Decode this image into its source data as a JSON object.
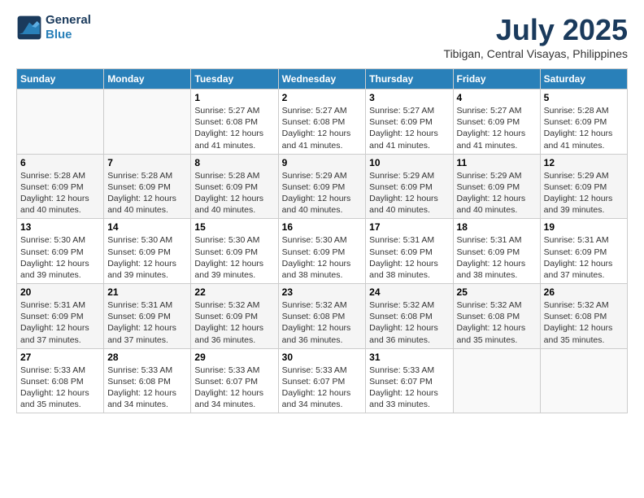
{
  "header": {
    "logo_line1": "General",
    "logo_line2": "Blue",
    "month": "July 2025",
    "location": "Tibigan, Central Visayas, Philippines"
  },
  "days_of_week": [
    "Sunday",
    "Monday",
    "Tuesday",
    "Wednesday",
    "Thursday",
    "Friday",
    "Saturday"
  ],
  "weeks": [
    [
      {
        "day": "",
        "info": ""
      },
      {
        "day": "",
        "info": ""
      },
      {
        "day": "1",
        "info": "Sunrise: 5:27 AM\nSunset: 6:08 PM\nDaylight: 12 hours and 41 minutes."
      },
      {
        "day": "2",
        "info": "Sunrise: 5:27 AM\nSunset: 6:08 PM\nDaylight: 12 hours and 41 minutes."
      },
      {
        "day": "3",
        "info": "Sunrise: 5:27 AM\nSunset: 6:09 PM\nDaylight: 12 hours and 41 minutes."
      },
      {
        "day": "4",
        "info": "Sunrise: 5:27 AM\nSunset: 6:09 PM\nDaylight: 12 hours and 41 minutes."
      },
      {
        "day": "5",
        "info": "Sunrise: 5:28 AM\nSunset: 6:09 PM\nDaylight: 12 hours and 41 minutes."
      }
    ],
    [
      {
        "day": "6",
        "info": "Sunrise: 5:28 AM\nSunset: 6:09 PM\nDaylight: 12 hours and 40 minutes."
      },
      {
        "day": "7",
        "info": "Sunrise: 5:28 AM\nSunset: 6:09 PM\nDaylight: 12 hours and 40 minutes."
      },
      {
        "day": "8",
        "info": "Sunrise: 5:28 AM\nSunset: 6:09 PM\nDaylight: 12 hours and 40 minutes."
      },
      {
        "day": "9",
        "info": "Sunrise: 5:29 AM\nSunset: 6:09 PM\nDaylight: 12 hours and 40 minutes."
      },
      {
        "day": "10",
        "info": "Sunrise: 5:29 AM\nSunset: 6:09 PM\nDaylight: 12 hours and 40 minutes."
      },
      {
        "day": "11",
        "info": "Sunrise: 5:29 AM\nSunset: 6:09 PM\nDaylight: 12 hours and 40 minutes."
      },
      {
        "day": "12",
        "info": "Sunrise: 5:29 AM\nSunset: 6:09 PM\nDaylight: 12 hours and 39 minutes."
      }
    ],
    [
      {
        "day": "13",
        "info": "Sunrise: 5:30 AM\nSunset: 6:09 PM\nDaylight: 12 hours and 39 minutes."
      },
      {
        "day": "14",
        "info": "Sunrise: 5:30 AM\nSunset: 6:09 PM\nDaylight: 12 hours and 39 minutes."
      },
      {
        "day": "15",
        "info": "Sunrise: 5:30 AM\nSunset: 6:09 PM\nDaylight: 12 hours and 39 minutes."
      },
      {
        "day": "16",
        "info": "Sunrise: 5:30 AM\nSunset: 6:09 PM\nDaylight: 12 hours and 38 minutes."
      },
      {
        "day": "17",
        "info": "Sunrise: 5:31 AM\nSunset: 6:09 PM\nDaylight: 12 hours and 38 minutes."
      },
      {
        "day": "18",
        "info": "Sunrise: 5:31 AM\nSunset: 6:09 PM\nDaylight: 12 hours and 38 minutes."
      },
      {
        "day": "19",
        "info": "Sunrise: 5:31 AM\nSunset: 6:09 PM\nDaylight: 12 hours and 37 minutes."
      }
    ],
    [
      {
        "day": "20",
        "info": "Sunrise: 5:31 AM\nSunset: 6:09 PM\nDaylight: 12 hours and 37 minutes."
      },
      {
        "day": "21",
        "info": "Sunrise: 5:31 AM\nSunset: 6:09 PM\nDaylight: 12 hours and 37 minutes."
      },
      {
        "day": "22",
        "info": "Sunrise: 5:32 AM\nSunset: 6:09 PM\nDaylight: 12 hours and 36 minutes."
      },
      {
        "day": "23",
        "info": "Sunrise: 5:32 AM\nSunset: 6:08 PM\nDaylight: 12 hours and 36 minutes."
      },
      {
        "day": "24",
        "info": "Sunrise: 5:32 AM\nSunset: 6:08 PM\nDaylight: 12 hours and 36 minutes."
      },
      {
        "day": "25",
        "info": "Sunrise: 5:32 AM\nSunset: 6:08 PM\nDaylight: 12 hours and 35 minutes."
      },
      {
        "day": "26",
        "info": "Sunrise: 5:32 AM\nSunset: 6:08 PM\nDaylight: 12 hours and 35 minutes."
      }
    ],
    [
      {
        "day": "27",
        "info": "Sunrise: 5:33 AM\nSunset: 6:08 PM\nDaylight: 12 hours and 35 minutes."
      },
      {
        "day": "28",
        "info": "Sunrise: 5:33 AM\nSunset: 6:08 PM\nDaylight: 12 hours and 34 minutes."
      },
      {
        "day": "29",
        "info": "Sunrise: 5:33 AM\nSunset: 6:07 PM\nDaylight: 12 hours and 34 minutes."
      },
      {
        "day": "30",
        "info": "Sunrise: 5:33 AM\nSunset: 6:07 PM\nDaylight: 12 hours and 34 minutes."
      },
      {
        "day": "31",
        "info": "Sunrise: 5:33 AM\nSunset: 6:07 PM\nDaylight: 12 hours and 33 minutes."
      },
      {
        "day": "",
        "info": ""
      },
      {
        "day": "",
        "info": ""
      }
    ]
  ]
}
